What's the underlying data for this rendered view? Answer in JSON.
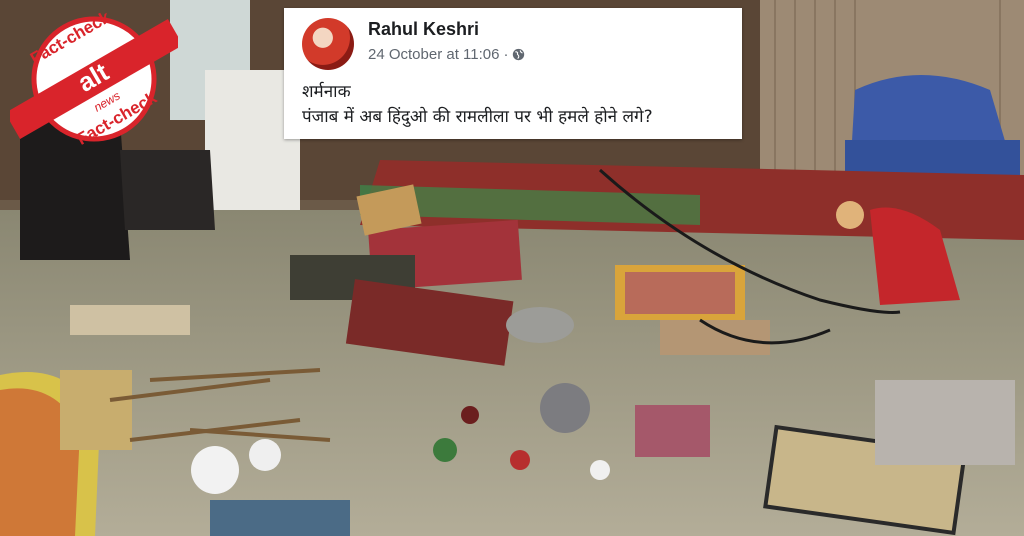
{
  "post": {
    "author": "Rahul Keshri",
    "timestamp": "24 October at 11:06",
    "separator": "·",
    "privacy_icon": "globe-icon",
    "lines": [
      "शर्मनाक",
      "पंजाब में अब हिंदुओ की रामलीला पर भी हमले होने लगे?"
    ]
  },
  "badge": {
    "top_text": "Fact-check",
    "bottom_text": "Fact-check",
    "logo_text": "alt",
    "logo_sub": "news",
    "colors": {
      "red": "#d9242b",
      "white": "#ffffff"
    }
  }
}
